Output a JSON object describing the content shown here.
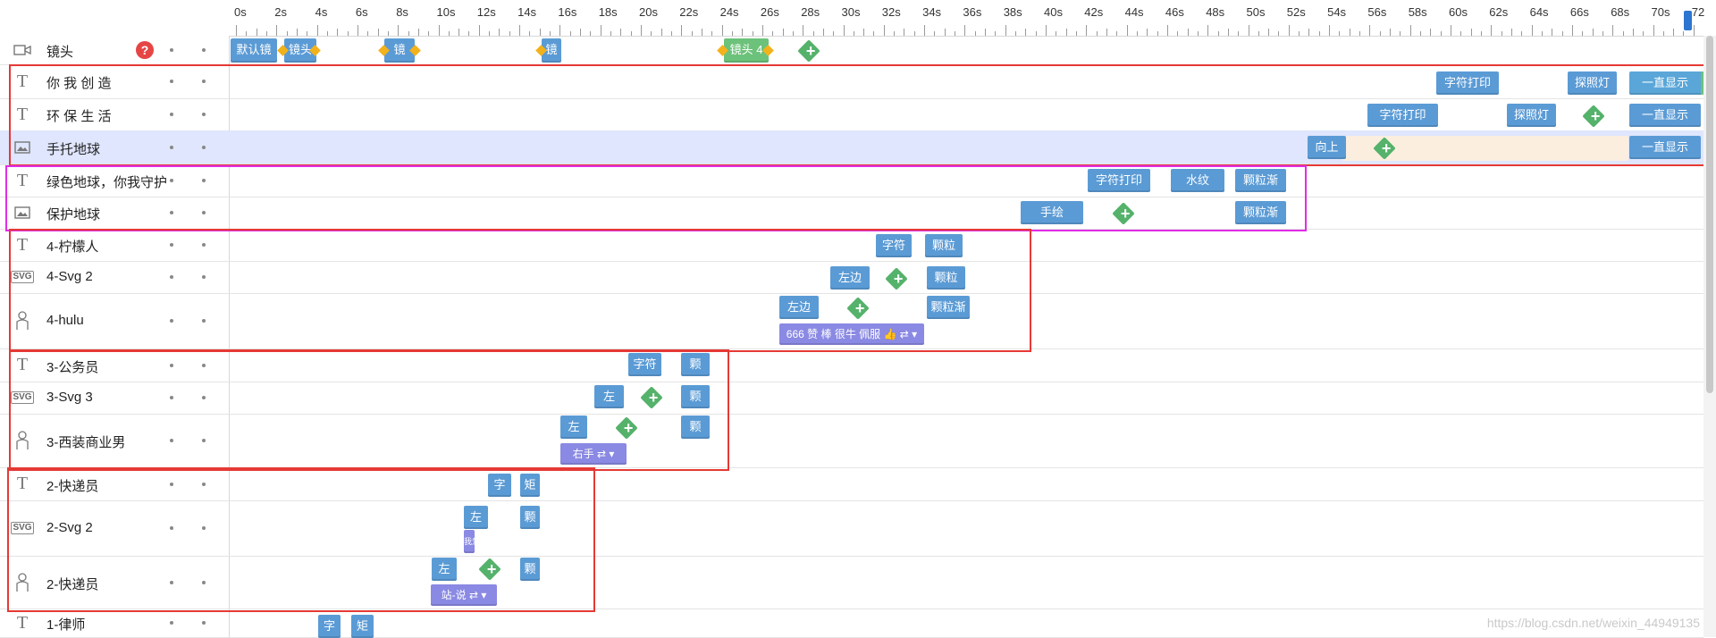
{
  "ruler": {
    "labels": [
      "0s",
      "2s",
      "4s",
      "6s",
      "8s",
      "10s",
      "12s",
      "14s",
      "16s",
      "18s",
      "20s",
      "22s",
      "24s",
      "26s",
      "28s",
      "30s",
      "32s",
      "34s",
      "36s",
      "38s",
      "40s",
      "42s",
      "44s",
      "46s",
      "48s",
      "50s",
      "52s",
      "54s",
      "56s",
      "58s",
      "60s",
      "62s",
      "64s",
      "66s",
      "68s",
      "70s",
      "72"
    ]
  },
  "rows": [
    {
      "name": "镜头",
      "icon": "camera-icon",
      "help": "?"
    },
    {
      "name": "你 我 创 造",
      "icon": "text-icon"
    },
    {
      "name": "环 保 生 活",
      "icon": "text-icon"
    },
    {
      "name": "手托地球",
      "icon": "image-icon"
    },
    {
      "name": "绿色地球，你我守护",
      "icon": "text-icon"
    },
    {
      "name": "保护地球",
      "icon": "image-icon"
    },
    {
      "name": "4-柠檬人",
      "icon": "text-icon"
    },
    {
      "name": "4-Svg 2",
      "icon": "svg-icon"
    },
    {
      "name": "4-hulu",
      "icon": "person-icon"
    },
    {
      "name": "3-公务员",
      "icon": "text-icon"
    },
    {
      "name": "3-Svg 3",
      "icon": "svg-icon"
    },
    {
      "name": "3-西装商业男",
      "icon": "person-icon"
    },
    {
      "name": "2-快递员",
      "icon": "text-icon"
    },
    {
      "name": "2-Svg 2",
      "icon": "svg-icon"
    },
    {
      "name": "2-快递员",
      "icon": "person-icon"
    },
    {
      "name": "1-律师",
      "icon": "text-icon"
    }
  ],
  "blocks": {
    "camera": [
      "默认镜",
      "镜头",
      "镜",
      "镜",
      "镜头 4"
    ],
    "r1": [
      "字符打印",
      "探照灯",
      "一直显示"
    ],
    "r2": [
      "字符打印",
      "探照灯",
      "一直显示"
    ],
    "r3": [
      "向上",
      "一直显示"
    ],
    "r4": [
      "字符打印",
      "水纹",
      "颗粒渐"
    ],
    "r5": [
      "手绘",
      "颗粒渐"
    ],
    "r6": [
      "字符",
      "颗粒"
    ],
    "r7": [
      "左边",
      "颗粒"
    ],
    "r8": [
      "左边",
      "颗粒渐",
      "666 赞 棒 很牛 佩服 👍 ⇄ ▾"
    ],
    "r9": [
      "字符",
      "颗"
    ],
    "r10": [
      "左",
      "颗"
    ],
    "r11": [
      "左",
      "颗",
      "右手 ⇄ ▾"
    ],
    "r12": [
      "字",
      "矩"
    ],
    "r13": [
      "左",
      "颗",
      "我爱"
    ],
    "r14": [
      "左",
      "颗",
      "站-说 ⇄ ▾"
    ],
    "r15": [
      "字",
      "矩"
    ]
  },
  "watermark": "https://blog.csdn.net/weixin_44949135",
  "colors": {
    "block": "#5b9bd5",
    "green": "#6cc27a",
    "purple": "#8a89e3",
    "highlight": "#dfe6fd",
    "red_box": "#e53935",
    "magenta_box": "#e12ce6"
  }
}
